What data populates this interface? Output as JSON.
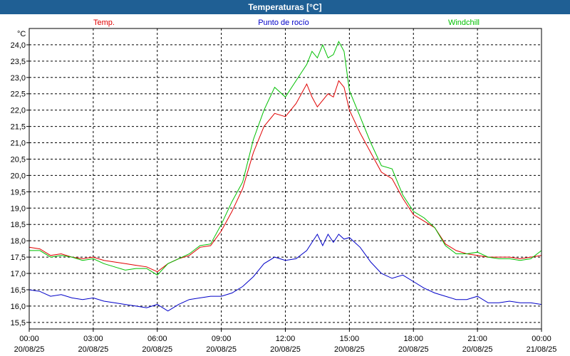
{
  "window": {
    "title": "Temperaturas [°C]"
  },
  "colors": {
    "title_bar": "#1f5f94",
    "temp": "#e00000",
    "dew": "#0000c8",
    "windchill": "#00c000",
    "grid": "#000000",
    "axis": "#000000"
  },
  "chart_data": {
    "type": "line",
    "title": "Temperaturas [°C]",
    "ylabel": "°C",
    "ylim": [
      15.3,
      24.5
    ],
    "y_ticks": [
      "15,5",
      "16,0",
      "16,5",
      "17,0",
      "17,5",
      "18,0",
      "18,5",
      "19,0",
      "19,5",
      "20,0",
      "20,5",
      "21,0",
      "21,5",
      "22,0",
      "22,5",
      "23,0",
      "23,5",
      "24,0"
    ],
    "y_tick_values": [
      15.5,
      16.0,
      16.5,
      17.0,
      17.5,
      18.0,
      18.5,
      19.0,
      19.5,
      20.0,
      20.5,
      21.0,
      21.5,
      22.0,
      22.5,
      23.0,
      23.5,
      24.0
    ],
    "x_unit": "hours",
    "xlim": [
      0,
      24
    ],
    "x_ticks": [
      {
        "time": "00:00",
        "date": "20/08/25"
      },
      {
        "time": "03:00",
        "date": "20/08/25"
      },
      {
        "time": "06:00",
        "date": "20/08/25"
      },
      {
        "time": "09:00",
        "date": "20/08/25"
      },
      {
        "time": "12:00",
        "date": "20/08/25"
      },
      {
        "time": "15:00",
        "date": "20/08/25"
      },
      {
        "time": "18:00",
        "date": "20/08/25"
      },
      {
        "time": "21:00",
        "date": "20/08/25"
      },
      {
        "time": "00:00",
        "date": "21/08/25"
      }
    ],
    "x": [
      0,
      0.5,
      1,
      1.5,
      2,
      2.5,
      3,
      3.5,
      4,
      4.5,
      5,
      5.5,
      6,
      6.5,
      7,
      7.5,
      8,
      8.5,
      9,
      9.5,
      10,
      10.5,
      11,
      11.5,
      12,
      12.5,
      13,
      13.25,
      13.5,
      13.75,
      14,
      14.25,
      14.5,
      14.75,
      15,
      15.5,
      16,
      16.5,
      17,
      17.5,
      18,
      18.5,
      19,
      19.5,
      20,
      20.5,
      21,
      21.5,
      22,
      22.5,
      23,
      23.5,
      24
    ],
    "series": [
      {
        "name": "Temp.",
        "color_key": "temp",
        "values": [
          17.8,
          17.75,
          17.55,
          17.6,
          17.5,
          17.45,
          17.5,
          17.4,
          17.35,
          17.3,
          17.25,
          17.2,
          17.05,
          17.3,
          17.45,
          17.55,
          17.8,
          17.85,
          18.3,
          18.9,
          19.6,
          20.7,
          21.5,
          21.9,
          21.8,
          22.2,
          22.8,
          22.4,
          22.1,
          22.3,
          22.5,
          22.4,
          22.9,
          22.7,
          22.0,
          21.3,
          20.7,
          20.1,
          19.9,
          19.3,
          18.8,
          18.6,
          18.4,
          17.9,
          17.7,
          17.6,
          17.55,
          17.5,
          17.5,
          17.5,
          17.45,
          17.5,
          17.55
        ]
      },
      {
        "name": "Punto de rocío",
        "color_key": "dew",
        "values": [
          16.5,
          16.45,
          16.3,
          16.35,
          16.25,
          16.2,
          16.25,
          16.15,
          16.1,
          16.05,
          16.0,
          15.95,
          16.05,
          15.85,
          16.05,
          16.2,
          16.25,
          16.3,
          16.3,
          16.4,
          16.6,
          16.9,
          17.3,
          17.5,
          17.4,
          17.45,
          17.7,
          17.95,
          18.2,
          17.85,
          18.2,
          17.95,
          18.2,
          18.05,
          18.1,
          17.8,
          17.35,
          17.0,
          16.85,
          16.95,
          16.75,
          16.55,
          16.4,
          16.3,
          16.2,
          16.2,
          16.3,
          16.1,
          16.1,
          16.15,
          16.1,
          16.1,
          16.05
        ]
      },
      {
        "name": "Windchill",
        "color_key": "windchill",
        "values": [
          17.7,
          17.7,
          17.5,
          17.55,
          17.5,
          17.4,
          17.45,
          17.3,
          17.2,
          17.1,
          17.15,
          17.15,
          16.95,
          17.3,
          17.45,
          17.6,
          17.85,
          17.9,
          18.5,
          19.2,
          19.8,
          21.1,
          22.0,
          22.7,
          22.4,
          22.9,
          23.4,
          23.8,
          23.6,
          24.0,
          23.6,
          23.7,
          24.1,
          23.8,
          22.6,
          21.8,
          21.0,
          20.3,
          20.2,
          19.4,
          18.9,
          18.7,
          18.4,
          17.85,
          17.6,
          17.6,
          17.65,
          17.5,
          17.45,
          17.45,
          17.4,
          17.45,
          17.7
        ]
      }
    ],
    "grid": true,
    "legend_position": "top"
  }
}
